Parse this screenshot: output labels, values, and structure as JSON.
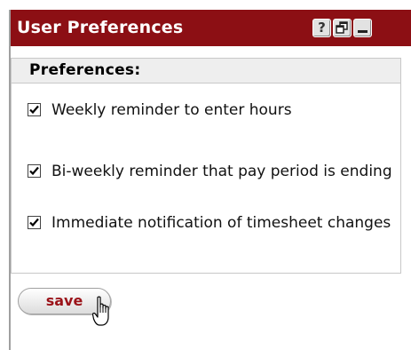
{
  "window": {
    "title": "User Preferences",
    "buttons": {
      "help_label": "?"
    }
  },
  "preferences": {
    "header": "Preferences:",
    "options": [
      {
        "label": "Weekly reminder to enter hours",
        "checked": true
      },
      {
        "label": "Bi-weekly reminder that pay period is ending",
        "checked": true
      },
      {
        "label": "Immediate notification of timesheet changes",
        "checked": true
      }
    ]
  },
  "actions": {
    "save_label": "save"
  },
  "colors": {
    "title_bar": "#8c0f14",
    "save_text": "#9b1319"
  }
}
